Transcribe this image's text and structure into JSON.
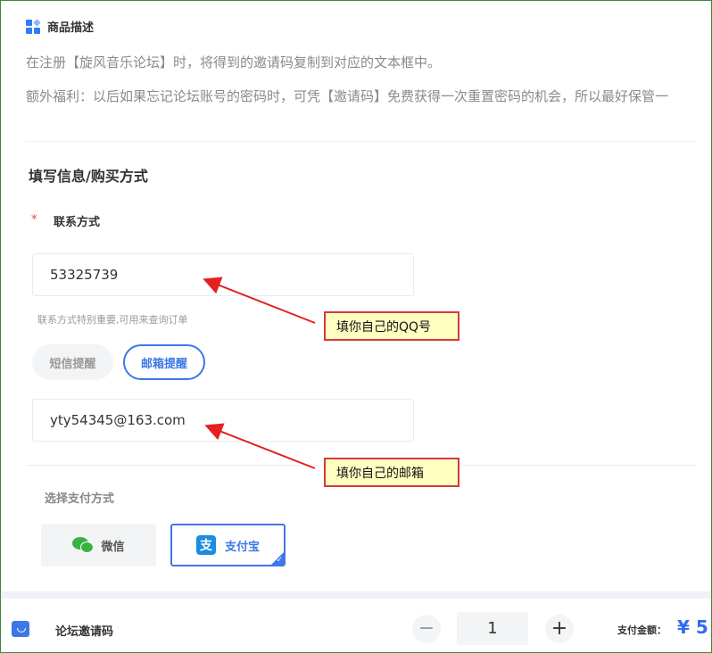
{
  "description": {
    "section_title": "商品描述",
    "line1": "在注册【旋风音乐论坛】时，将得到的邀请码复制到对应的文本框中。",
    "line2": "额外福利：以后如果忘记论坛账号的密码时，可凭【邀请码】免费获得一次重置密码的机会，所以最好保管一"
  },
  "form": {
    "title": "填写信息/购买方式",
    "required_mark": "*",
    "contact_label": "联系方式",
    "contact_value": "53325739",
    "contact_hint": "联系方式特别重要,可用来查询订单",
    "notify_options": [
      "短信提醒",
      "邮箱提醒"
    ],
    "notify_selected": "邮箱提醒",
    "email_value": "yty54345@163.com"
  },
  "payment": {
    "label": "选择支付方式",
    "options": [
      {
        "label": "微信",
        "icon": "wechat-icon"
      },
      {
        "label": "支付宝",
        "icon": "alipay-icon"
      }
    ],
    "selected": "支付宝",
    "alipay_glyph": "支",
    "check_glyph": "✓"
  },
  "footer": {
    "product_name": "论坛邀请码",
    "minus": "−",
    "plus": "+",
    "quantity": "1",
    "total_label": "支付金额：",
    "total_value": "¥ 5"
  },
  "annotations": {
    "qq_note": "填你自己的QQ号",
    "email_note": "填你自己的邮箱",
    "color": "#e52020"
  },
  "colors": {
    "accent": "#3d77e8",
    "wechat": "#3bb142",
    "alipay": "#1c8ce0"
  }
}
